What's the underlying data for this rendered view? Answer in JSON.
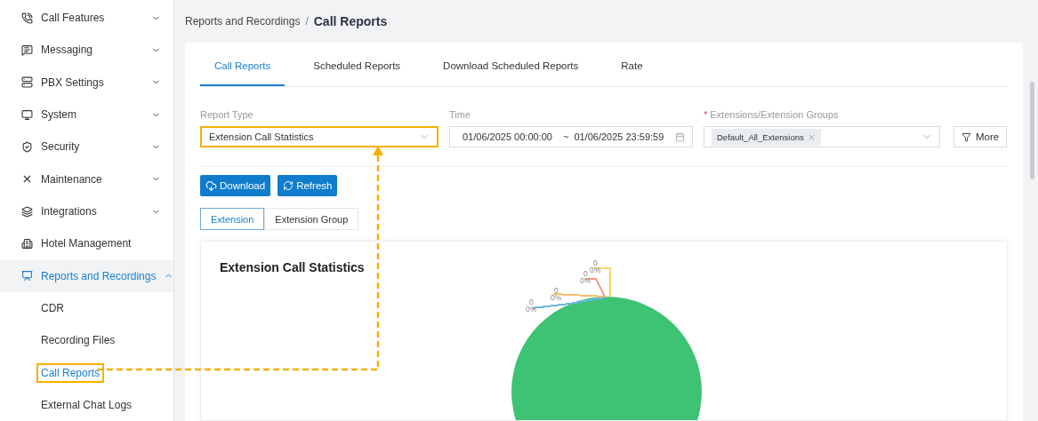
{
  "sidebar": {
    "items": [
      {
        "label": "Call Features",
        "expanded": false,
        "selected": false
      },
      {
        "label": "Messaging",
        "expanded": false,
        "selected": false
      },
      {
        "label": "PBX Settings",
        "expanded": false,
        "selected": false
      },
      {
        "label": "System",
        "expanded": false,
        "selected": false
      },
      {
        "label": "Security",
        "expanded": false,
        "selected": false
      },
      {
        "label": "Maintenance",
        "expanded": false,
        "selected": false
      },
      {
        "label": "Integrations",
        "expanded": false,
        "selected": false
      },
      {
        "label": "Hotel Management",
        "selected": false
      },
      {
        "label": "Reports and Recordings",
        "expanded": true,
        "selected": true,
        "children": [
          {
            "label": "CDR",
            "selected": false,
            "highlighted": false
          },
          {
            "label": "Recording Files",
            "selected": false,
            "highlighted": false
          },
          {
            "label": "Call Reports",
            "selected": true,
            "highlighted": true
          },
          {
            "label": "External Chat Logs",
            "selected": false,
            "highlighted": false
          }
        ]
      }
    ]
  },
  "breadcrumb": {
    "parent": "Reports and Recordings",
    "separator": "/",
    "current": "Call Reports"
  },
  "tabs": [
    {
      "label": "Call Reports",
      "selected": true
    },
    {
      "label": "Scheduled Reports",
      "selected": false
    },
    {
      "label": "Download Scheduled Reports",
      "selected": false
    },
    {
      "label": "Rate",
      "selected": false
    }
  ],
  "filters": {
    "report_type": {
      "label": "Report Type",
      "value": "Extension Call Statistics",
      "highlighted": true
    },
    "time": {
      "label": "Time",
      "start": "01/06/2025 00:00:00",
      "separator": "~",
      "end": "01/06/2025 23:59:59"
    },
    "extensions": {
      "required_mark": "*",
      "label": "Extensions/Extension Groups",
      "tags": [
        "Default_All_Extensions"
      ]
    },
    "more_button": "More"
  },
  "actions": [
    "Download",
    "Refresh"
  ],
  "segments": [
    {
      "label": "Extension",
      "selected": true
    },
    {
      "label": "Extension Group",
      "selected": false
    }
  ],
  "chart": {
    "title": "Extension Call Statistics",
    "pie_labels": [
      {
        "value": "0",
        "percent": "0%",
        "color": "#f9d66e"
      },
      {
        "value": "0",
        "percent": "0%",
        "color": "#ef9a7c"
      },
      {
        "value": "0",
        "percent": "0%",
        "color": "#f6bd6a"
      },
      {
        "value": "0",
        "percent": "0%",
        "color": "#6cb6e2"
      }
    ]
  }
}
